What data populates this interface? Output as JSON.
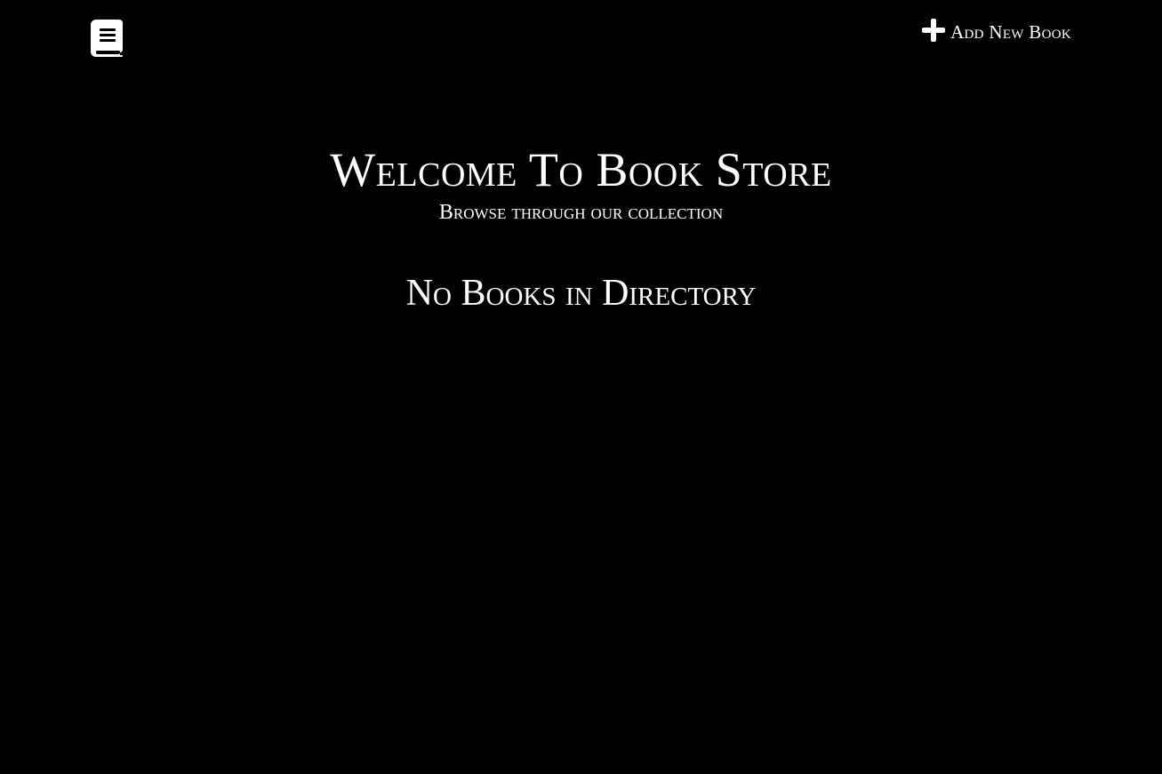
{
  "navbar": {
    "logo_icon": "book-icon",
    "add_icon": "plus-icon",
    "add_label": "Add New Book"
  },
  "hero": {
    "title": "Welcome To Book Store",
    "subtitle": "Browse through our collection"
  },
  "main": {
    "empty_message": "No Books in Directory"
  },
  "colors": {
    "background": "#000000",
    "text": "#ffffff"
  }
}
